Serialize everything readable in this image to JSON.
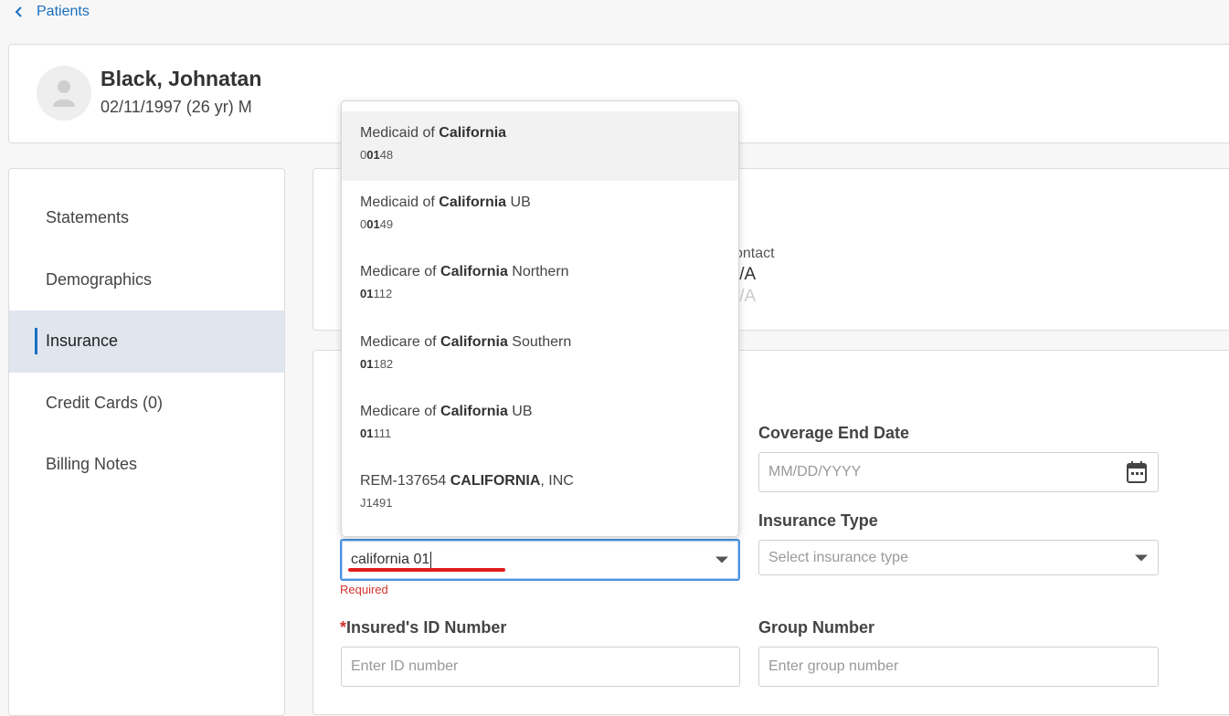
{
  "nav": {
    "back_label": "Patients"
  },
  "patient": {
    "name": "Black, Johnatan",
    "dob_line": "02/11/1997 (26 yr) M"
  },
  "sidebar": {
    "items": [
      {
        "label": "Statements",
        "active": false
      },
      {
        "label": "Demographics",
        "active": false
      },
      {
        "label": "Insurance",
        "active": true
      },
      {
        "label": "Credit Cards (0)",
        "active": false
      },
      {
        "label": "Billing Notes",
        "active": false
      }
    ]
  },
  "contact": {
    "label": "ontact",
    "value": "I/A",
    "value2": "I/A"
  },
  "form": {
    "coverage_end": {
      "label": "Coverage End Date",
      "placeholder": "MM/DD/YYYY"
    },
    "insurance_type": {
      "label": "Insurance Type",
      "placeholder": "Select insurance type"
    },
    "payer_search": {
      "value": "california 01",
      "error": "Required"
    },
    "insured_id": {
      "req_mark": "*",
      "label": "Insured's ID Number",
      "placeholder": "Enter ID number"
    },
    "group_number": {
      "label": "Group Number",
      "placeholder": "Enter group number"
    }
  },
  "dropdown": {
    "options": [
      {
        "pre": "Medicaid of ",
        "bold": "California",
        "post": "",
        "code_pre": "0",
        "code_bold": "01",
        "code_post": "48",
        "highlighted": true
      },
      {
        "pre": "Medicaid of ",
        "bold": "California",
        "post": " UB",
        "code_pre": "0",
        "code_bold": "01",
        "code_post": "49",
        "highlighted": false
      },
      {
        "pre": "Medicare of ",
        "bold": "California",
        "post": " Northern",
        "code_pre": "",
        "code_bold": "01",
        "code_post": "112",
        "highlighted": false
      },
      {
        "pre": "Medicare of ",
        "bold": "California",
        "post": " Southern",
        "code_pre": "",
        "code_bold": "01",
        "code_post": "182",
        "highlighted": false
      },
      {
        "pre": "Medicare of ",
        "bold": "California",
        "post": " UB",
        "code_pre": "",
        "code_bold": "01",
        "code_post": "111",
        "highlighted": false
      },
      {
        "pre": "REM-137654 ",
        "bold": "CALIFORNIA",
        "post": ", INC",
        "code_pre": "J1491",
        "code_bold": "",
        "code_post": "",
        "highlighted": false
      }
    ]
  },
  "colors": {
    "accent": "#1a6fbf",
    "error": "#d0342c",
    "focus_border": "#4a90e2",
    "annotation": "#e21b1b"
  }
}
